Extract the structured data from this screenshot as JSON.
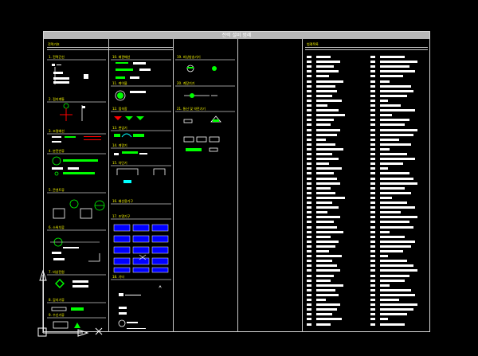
{
  "drawing": {
    "title": "전력 설비 범례",
    "colors": {
      "background": "#000000",
      "frame": "#d8d8d8",
      "title_bar": "#b8b8b8",
      "symbol": "#00ff00",
      "text": "#ffffff",
      "heading": "#ffff00",
      "accent_red": "#ff0000",
      "accent_blue": "#0000ff"
    }
  },
  "panels": {
    "left_header": "전력기호",
    "legend_header": "범례목록"
  },
  "sections_col1": [
    "1. 전력간선",
    "2. 접지계통",
    "3. 조명배선",
    "4. 분전반류",
    "5. 콘센트류",
    "6. 스위치류",
    "7. 비상전원",
    "8. 감지기류",
    "9. 수신기류"
  ],
  "sections_col2": [
    "10. 배관배선",
    "11. 케이블",
    "12. 접속함",
    "13. 변압기",
    "14. 계량기",
    "15. 차단기",
    "16. 배선용기구",
    "17. 조명기구",
    "18. 기타"
  ],
  "sections_col3": [
    "19. 비상방송기기",
    "20. 계장기기",
    "21. 통신 및 약전기기"
  ],
  "ucs_icon": "ucs-axis-icon"
}
